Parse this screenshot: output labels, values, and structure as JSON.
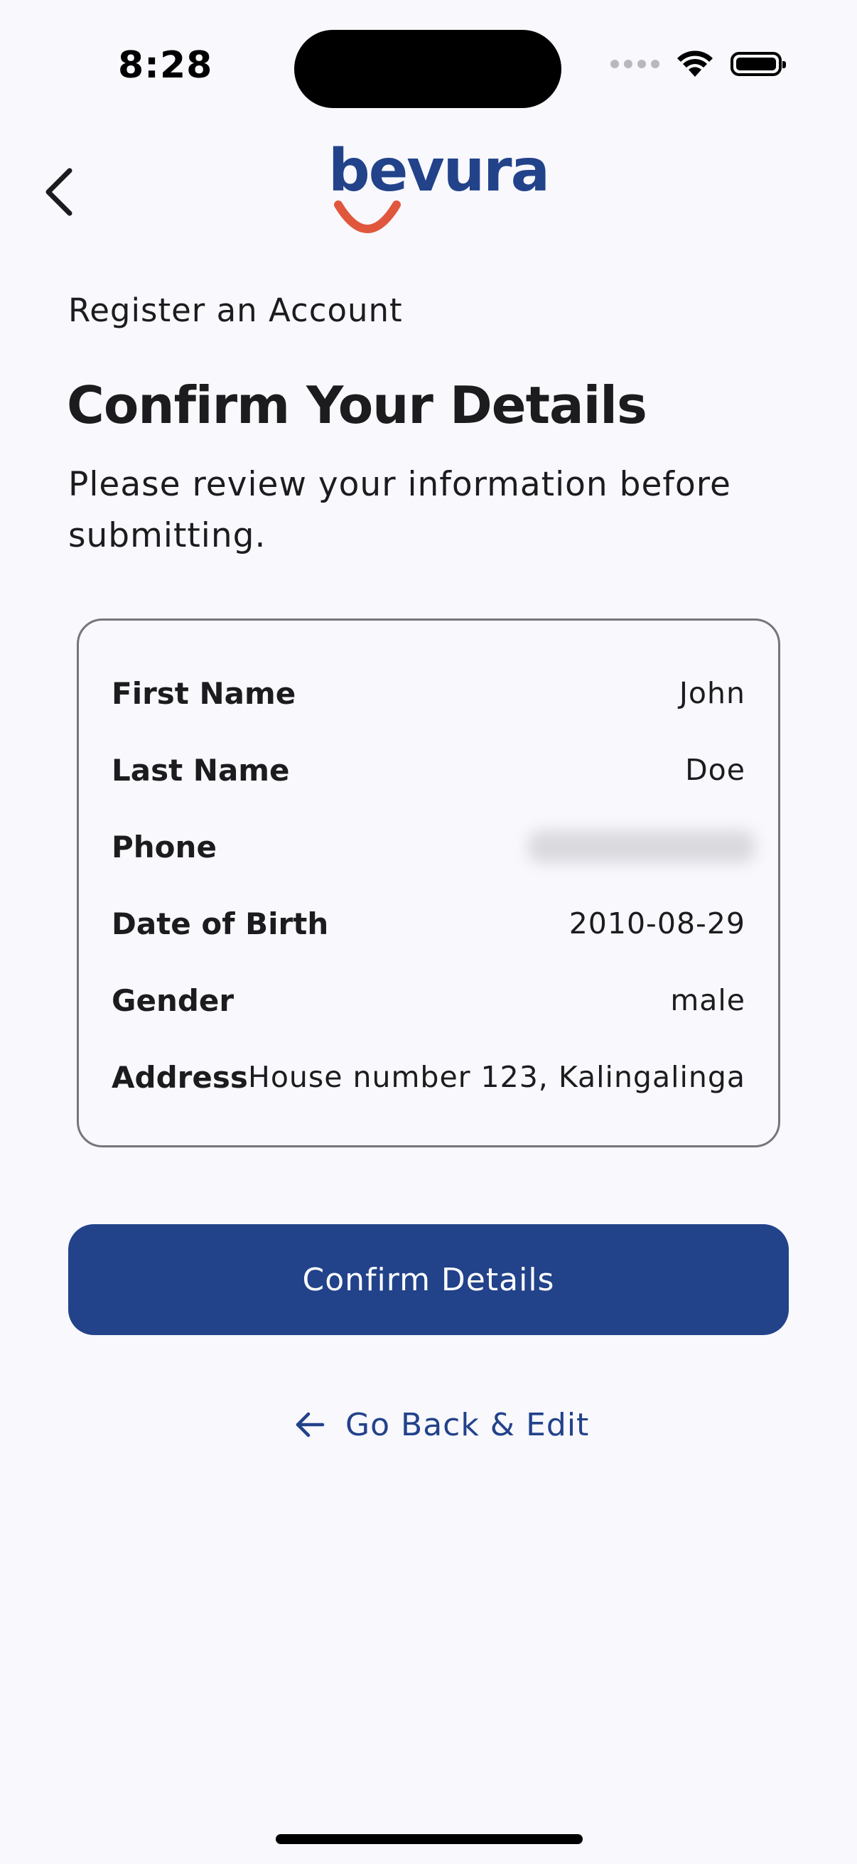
{
  "status_bar": {
    "time": "8:28",
    "icons": [
      "cellular-signal-icon",
      "wifi-icon",
      "battery-icon"
    ]
  },
  "header": {
    "back_icon": "chevron-left-icon",
    "logo_text": "bevura"
  },
  "page": {
    "eyebrow": "Register an Account",
    "title": "Confirm Your Details",
    "subtitle": "Please review your information before submitting."
  },
  "details": {
    "rows": [
      {
        "label": "First Name",
        "value": "John"
      },
      {
        "label": "Last Name",
        "value": "Doe"
      },
      {
        "label": "Phone",
        "value": ""
      },
      {
        "label": "Date of Birth",
        "value": "2010-08-29"
      },
      {
        "label": "Gender",
        "value": "male"
      },
      {
        "label": "Address",
        "value": "House number 123, Kalingalinga"
      }
    ]
  },
  "actions": {
    "confirm_label": "Confirm Details",
    "back_edit_label": "Go Back & Edit",
    "back_edit_icon": "arrow-left-icon"
  },
  "colors": {
    "brand_blue": "#22428a",
    "brand_orange": "#e0573e",
    "background": "#f8f8fd",
    "card_border": "#76767a"
  }
}
